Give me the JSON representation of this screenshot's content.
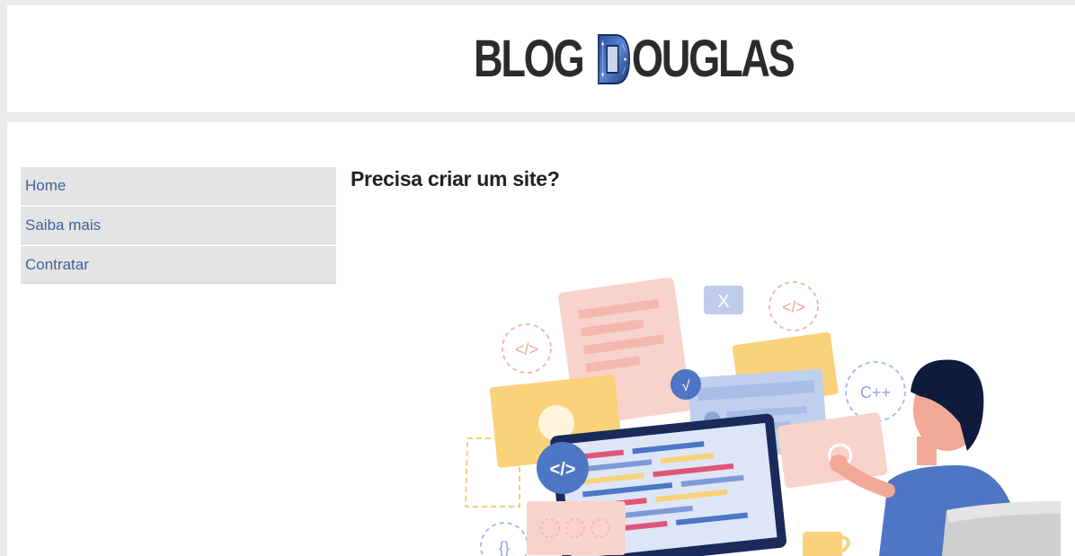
{
  "header": {
    "logo_text_left": "BLOG",
    "logo_text_right": "OUGLAS",
    "logo_letter": "D"
  },
  "menu": {
    "items": [
      {
        "label": "Home"
      },
      {
        "label": "Saiba mais"
      },
      {
        "label": "Contratar"
      }
    ]
  },
  "main": {
    "headline": "Precisa criar um site?",
    "illustration": {
      "icons": [
        "code-icon",
        "close-icon",
        "check-icon",
        "cpp-badge",
        "braces-icon"
      ],
      "badge_texts": {
        "cpp": "C++",
        "code": "</>",
        "braces": "{}",
        "close": "X",
        "check": "√"
      }
    }
  },
  "colors": {
    "page_bg": "#ececec",
    "panel_bg": "#ffffff",
    "menu_bg": "#e4e4e4",
    "menu_text": "#43609c",
    "logo_text": "#2b2b2b",
    "accent_blue": "#4d76c4",
    "accent_yellow": "#f9d27a",
    "accent_pink": "#f6c9c3",
    "dark_navy": "#0f1b3d"
  }
}
